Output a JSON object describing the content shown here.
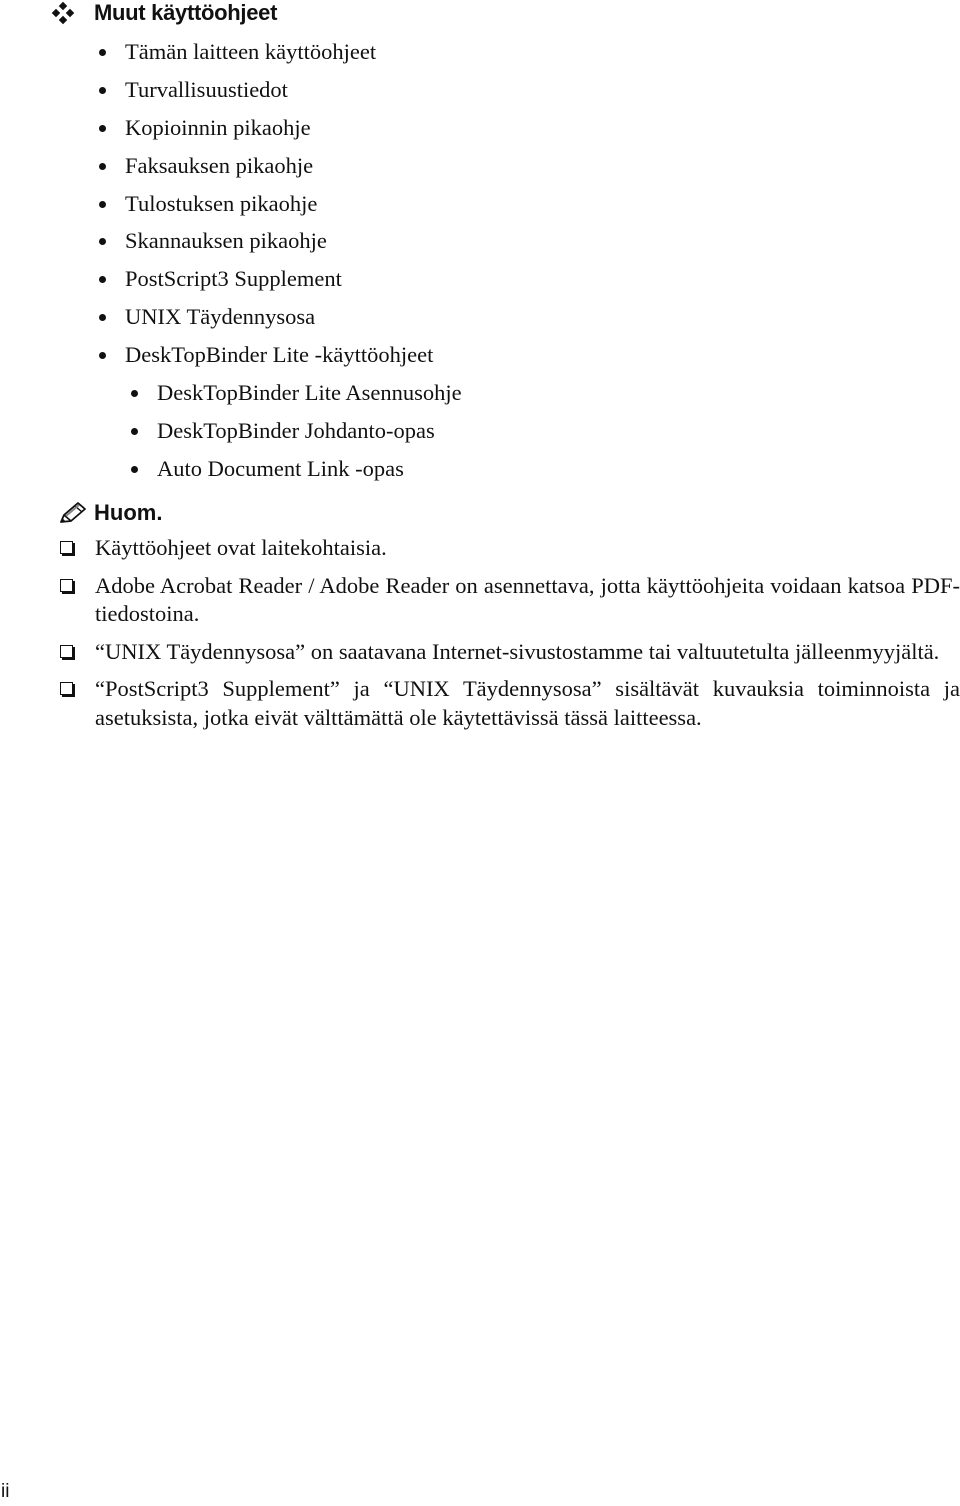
{
  "section": {
    "icon": "four-diamonds-icon",
    "title": "Muut käyttöohjeet"
  },
  "manuals": [
    {
      "label": "Tämän laitteen käyttöohjeet",
      "level": 1
    },
    {
      "label": "Turvallisuustiedot",
      "level": 1
    },
    {
      "label": "Kopioinnin pikaohje",
      "level": 1
    },
    {
      "label": "Faksauksen pikaohje",
      "level": 1
    },
    {
      "label": "Tulostuksen pikaohje",
      "level": 1
    },
    {
      "label": "Skannauksen pikaohje",
      "level": 1
    },
    {
      "label": "PostScript3 Supplement",
      "level": 1
    },
    {
      "label": "UNIX Täydennysosa",
      "level": 1
    },
    {
      "label": "DeskTopBinder Lite -käyttöohjeet",
      "level": 1
    },
    {
      "label": "DeskTopBinder Lite Asennusohje",
      "level": 2
    },
    {
      "label": "DeskTopBinder Johdanto-opas",
      "level": 2
    },
    {
      "label": "Auto Document Link -opas",
      "level": 2
    }
  ],
  "note": {
    "icon": "pencil-icon",
    "title": "Huom.",
    "items": [
      "Käyttöohjeet ovat laitekohtaisia.",
      "Adobe Acrobat Reader / Adobe Reader on asennettava, jotta käyttöohjeita voidaan katsoa PDF-tiedostoina.",
      "“UNIX Täydennysosa” on saatavana Internet-sivustostamme tai valtuutetulta jälleenmyyjältä.",
      "“PostScript3 Supplement” ja “UNIX Täydennysosa” sisältävät kuvauksia toiminnoista ja asetuksista, jotka eivät välttämättä ole käytettävissä tässä laitteessa."
    ]
  },
  "footer": {
    "page_number": "ii"
  }
}
